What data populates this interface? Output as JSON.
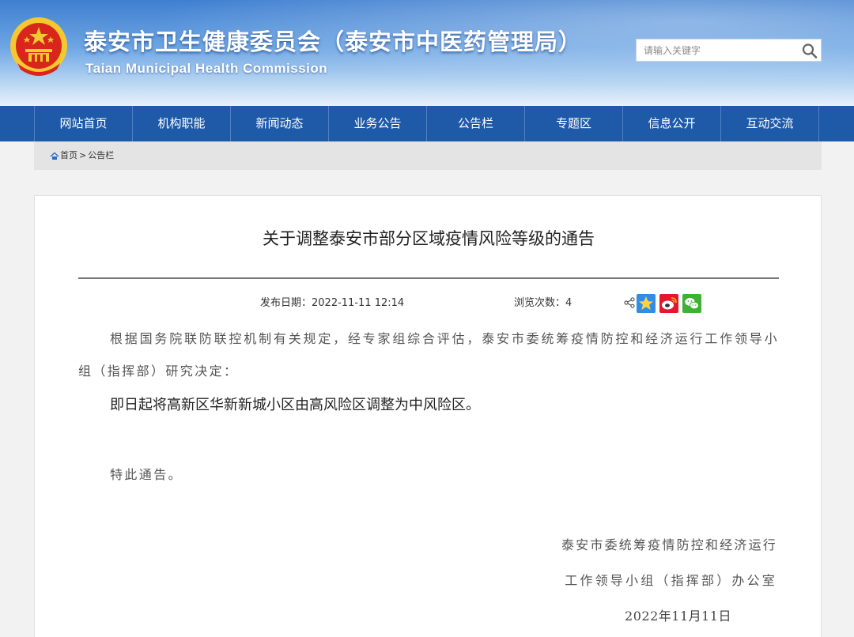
{
  "header": {
    "title_cn": "泰安市卫生健康委员会（泰安市中医药管理局）",
    "title_en": "Taian Municipal Health Commission",
    "emblem_icon": "national-emblem-icon"
  },
  "search": {
    "placeholder": "请输入关键字",
    "icon": "search-icon"
  },
  "nav": {
    "items": [
      "网站首页",
      "机构职能",
      "新闻动态",
      "业务公告",
      "公告栏",
      "专题区",
      "信息公开",
      "互动交流"
    ]
  },
  "breadcrumb": {
    "home": "首页",
    "separator": ">",
    "current": "公告栏"
  },
  "article": {
    "title": "关于调整泰安市部分区域疫情风险等级的通告",
    "publish_label": "发布日期：",
    "publish_date": "2022-11-11 12:14",
    "views_label": "浏览次数：",
    "views": "4",
    "share_icons": [
      "share-icon",
      "qzone-icon",
      "weibo-icon",
      "wechat-icon"
    ],
    "paragraph1": "根据国务院联防联控机制有关规定，经专家组综合评估，泰安市委统筹疫情防控和经济运行工作领导小组（指挥部）研究决定：",
    "paragraph2": "即日起将高新区华新新城小区由高风险区调整为中风险区。",
    "paragraph3": "特此通告。",
    "signature_line1": "泰安市委统筹疫情防控和经济运行",
    "signature_line2": "工作领导小组（指挥部）办公室",
    "signature_date": "2022年11月11日"
  },
  "colors": {
    "nav_bg": "#1e5aa8",
    "header_top": "#3f7fd0",
    "emblem_red": "#d9261c",
    "emblem_gold": "#f6c830"
  }
}
